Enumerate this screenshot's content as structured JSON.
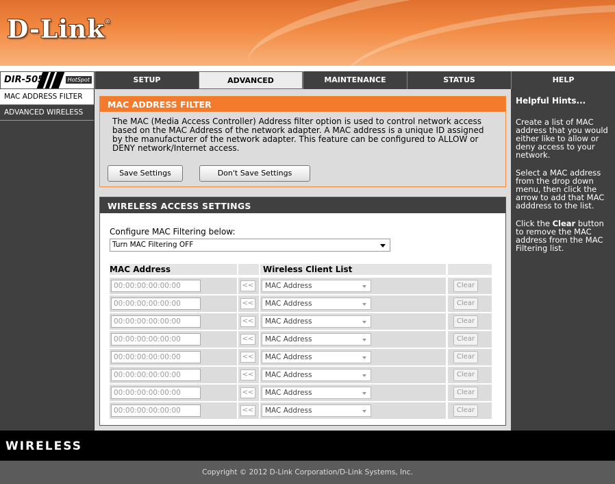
{
  "brand": {
    "logo_text": "D-Link",
    "logo_mark": "®"
  },
  "model": {
    "name": "DIR-505",
    "tag": "HotSpot"
  },
  "nav": {
    "tabs": [
      {
        "label": "SETUP"
      },
      {
        "label": "ADVANCED"
      },
      {
        "label": "MAINTENANCE"
      },
      {
        "label": "STATUS"
      },
      {
        "label": "HELP"
      }
    ],
    "active_tab": "ADVANCED"
  },
  "sidebar": {
    "items": [
      {
        "label": "MAC ADDRESS FILTER"
      },
      {
        "label": "ADVANCED WIRELESS"
      }
    ]
  },
  "filter": {
    "title": "MAC ADDRESS FILTER",
    "description": "The MAC (Media Access Controller) Address filter option is used to control network access based on the MAC Address of the network adapter. A MAC address is a unique ID assigned by the manufacturer of the network adapter. This feature can be configured to ALLOW or DENY network/Internet access.",
    "save_label": "Save Settings",
    "dont_save_label": "Don't Save Settings"
  },
  "wireless": {
    "title": "WIRELESS ACCESS SETTINGS",
    "configure_label": "Configure MAC Filtering below:",
    "configure_value": "Turn MAC Filtering OFF",
    "col_mac": "MAC Address",
    "col_client": "Wireless Client List",
    "rows": [
      {
        "mac": "00:00:00:00:00:00",
        "arrow": "<<",
        "client": "MAC Address",
        "clear": "Clear"
      },
      {
        "mac": "00:00:00:00:00:00",
        "arrow": "<<",
        "client": "MAC Address",
        "clear": "Clear"
      },
      {
        "mac": "00:00:00:00:00:00",
        "arrow": "<<",
        "client": "MAC Address",
        "clear": "Clear"
      },
      {
        "mac": "00:00:00:00:00:00",
        "arrow": "<<",
        "client": "MAC Address",
        "clear": "Clear"
      },
      {
        "mac": "00:00:00:00:00:00",
        "arrow": "<<",
        "client": "MAC Address",
        "clear": "Clear"
      },
      {
        "mac": "00:00:00:00:00:00",
        "arrow": "<<",
        "client": "MAC Address",
        "clear": "Clear"
      },
      {
        "mac": "00:00:00:00:00:00",
        "arrow": "<<",
        "client": "MAC Address",
        "clear": "Clear"
      },
      {
        "mac": "00:00:00:00:00:00",
        "arrow": "<<",
        "client": "MAC Address",
        "clear": "Clear"
      }
    ]
  },
  "help": {
    "title": "Helpful Hints...",
    "hint1": "Create a list of MAC address that you would either like to allow or deny access to your network.",
    "hint2": "Select a MAC address from the drop down menu, then click the arrow to add that MAC adddress to the list.",
    "hint3_pre": "Click the ",
    "hint3_bold": "Clear",
    "hint3_post": " button to remove the MAC address from the MAC Filtering list."
  },
  "footer": {
    "brand": "WIRELESS",
    "copyright": "Copyright © 2012 D-Link Corporation/D-Link Systems, Inc."
  },
  "colors": {
    "accent_orange": "#f47a2c",
    "dark_gray": "#404040",
    "panel_gray": "#dcdcdc"
  }
}
